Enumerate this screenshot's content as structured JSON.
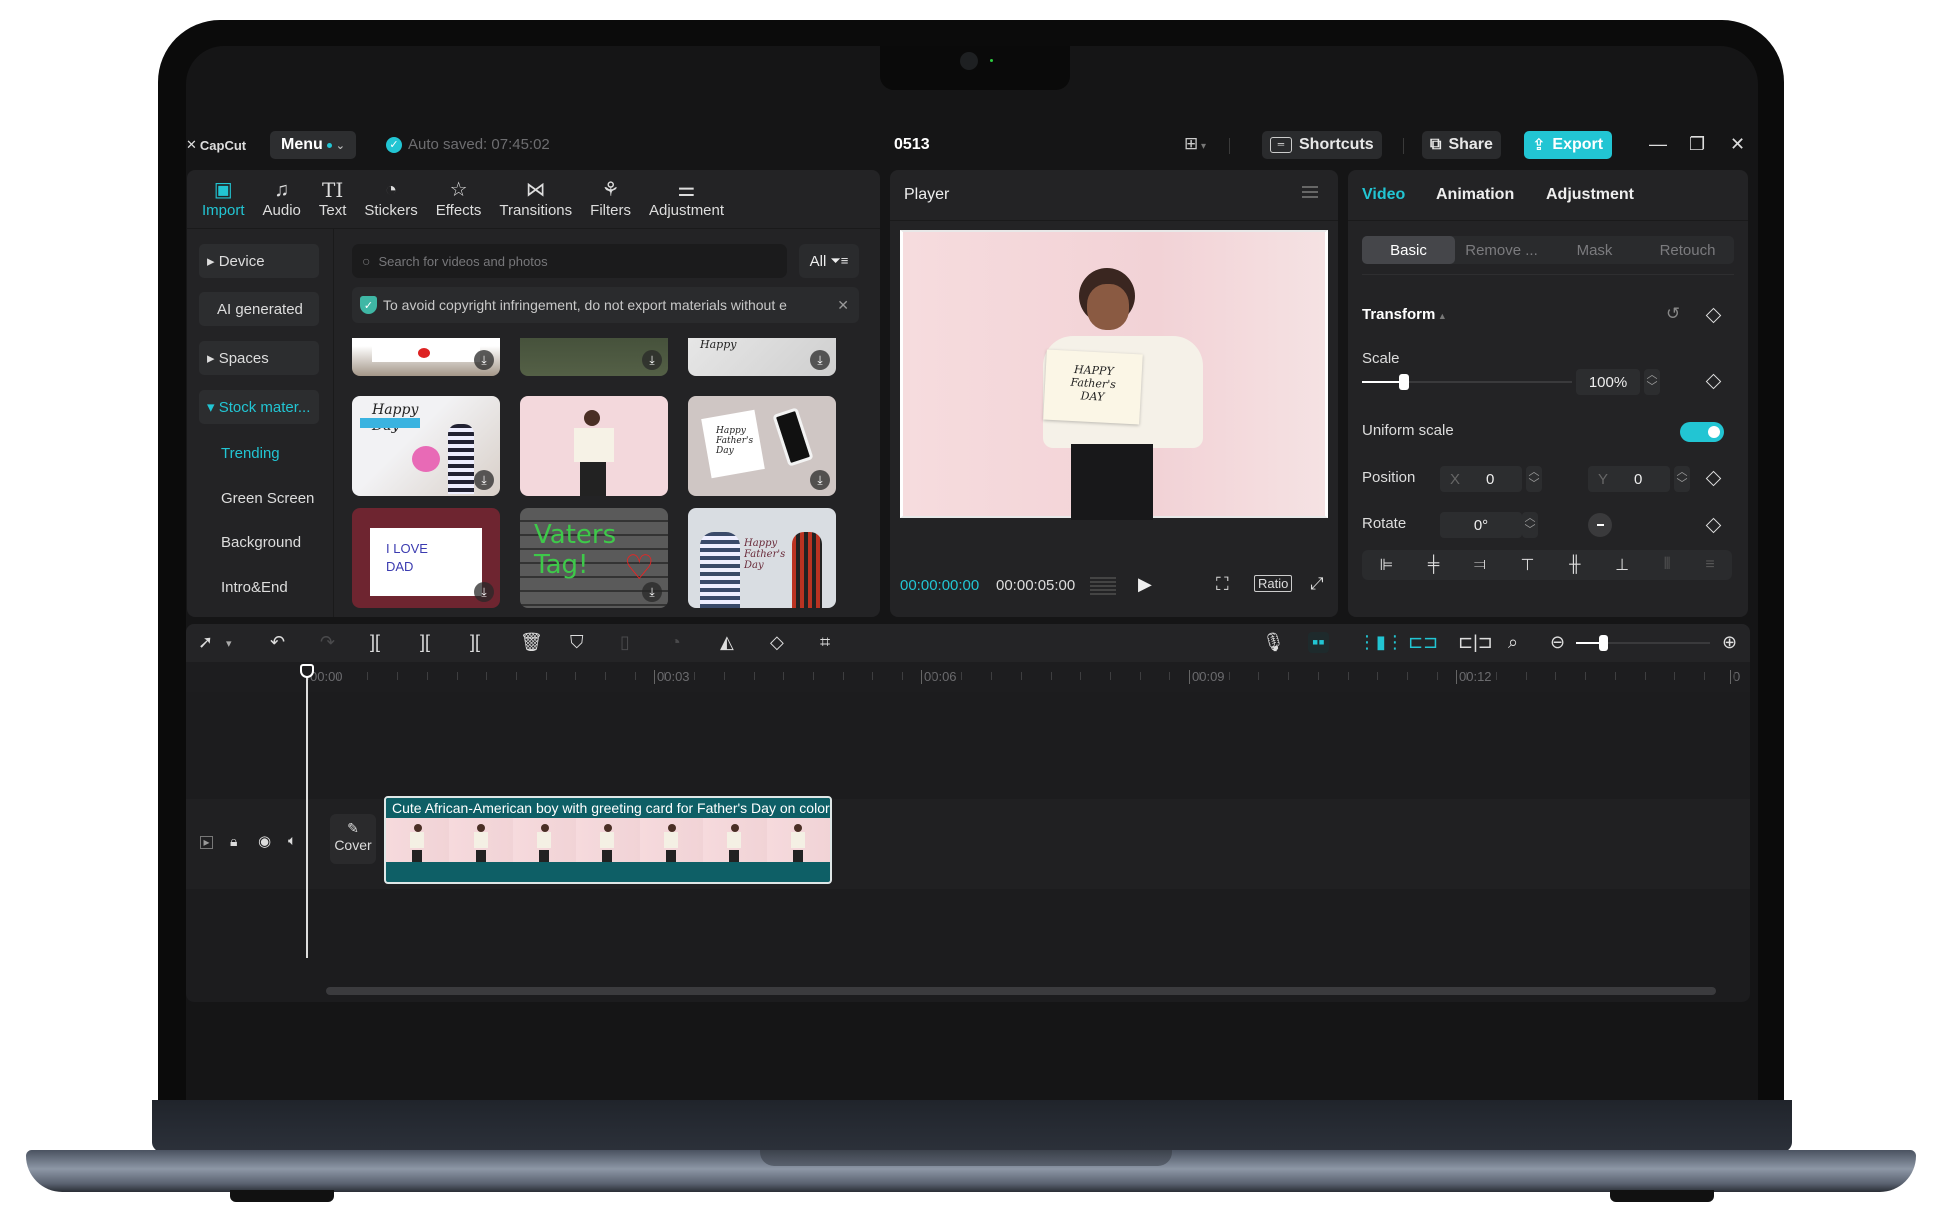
{
  "app": {
    "logo": "CapCut",
    "menu_label": "Menu",
    "autosave": "Auto saved: 07:45:02",
    "project_name": "0513",
    "shortcuts_label": "Shortcuts",
    "share_label": "Share",
    "export_label": "Export",
    "accent": "#22c5d3"
  },
  "toolbar": {
    "items": [
      {
        "label": "Import",
        "icon": "import-icon",
        "glyph": "▣",
        "active": true
      },
      {
        "label": "Audio",
        "icon": "audio-icon",
        "glyph": "♫"
      },
      {
        "label": "Text",
        "icon": "text-icon",
        "glyph": "TI"
      },
      {
        "label": "Stickers",
        "icon": "stickers-icon",
        "glyph": "◔"
      },
      {
        "label": "Effects",
        "icon": "effects-icon",
        "glyph": "☆"
      },
      {
        "label": "Transitions",
        "icon": "transitions-icon",
        "glyph": "⋈"
      },
      {
        "label": "Filters",
        "icon": "filters-icon",
        "glyph": "⚘"
      },
      {
        "label": "Adjustment",
        "icon": "adjustment-icon",
        "glyph": "⚌"
      }
    ]
  },
  "sidebar": {
    "items": [
      {
        "label": "▸ Device"
      },
      {
        "label": "AI generated"
      },
      {
        "label": "▸ Spaces"
      },
      {
        "label": "▾ Stock mater..."
      },
      {
        "label": "Trending"
      },
      {
        "label": "Green Screen"
      },
      {
        "label": "Background"
      },
      {
        "label": "Intro&End"
      }
    ]
  },
  "media": {
    "search_placeholder": "Search for videos and photos",
    "filter_label": "All",
    "notice": "To avoid copyright infringement, do not export materials without e",
    "thumbnails": [
      {
        "caption": ""
      },
      {
        "caption": ""
      },
      {
        "caption": "Happy"
      },
      {
        "caption": "Happy Day"
      },
      {
        "caption": ""
      },
      {
        "caption": "Happy Father's Day"
      },
      {
        "caption": "I LOVE DAD"
      },
      {
        "caption": "Vaters Tag!"
      },
      {
        "caption": "Happy Father's Day"
      }
    ]
  },
  "player": {
    "title": "Player",
    "current_time": "00:00:00:00",
    "duration": "00:00:05:00",
    "ratio_label": "Ratio",
    "card_text": "HAPPY Father's DAY"
  },
  "properties": {
    "tabs": [
      "Video",
      "Animation",
      "Adjustment"
    ],
    "subtabs": [
      "Basic",
      "Remove ...",
      "Mask",
      "Retouch"
    ],
    "section": "Transform",
    "scale_label": "Scale",
    "scale_value": "100%",
    "scale_fraction": 0.2,
    "uniform_label": "Uniform scale",
    "uniform_on": true,
    "position_label": "Position",
    "x_label": "X",
    "x_value": "0",
    "y_label": "Y",
    "y_value": "0",
    "rotate_label": "Rotate",
    "rotate_value": "0°"
  },
  "timeline": {
    "ruler": [
      "00:00",
      "00:03",
      "00:06",
      "00:09",
      "00:12",
      "0"
    ],
    "cover_label": "Cover",
    "clip_title": "Cute African-American boy with greeting card for Father's Day on color background",
    "zoom_fraction": 0.2
  }
}
